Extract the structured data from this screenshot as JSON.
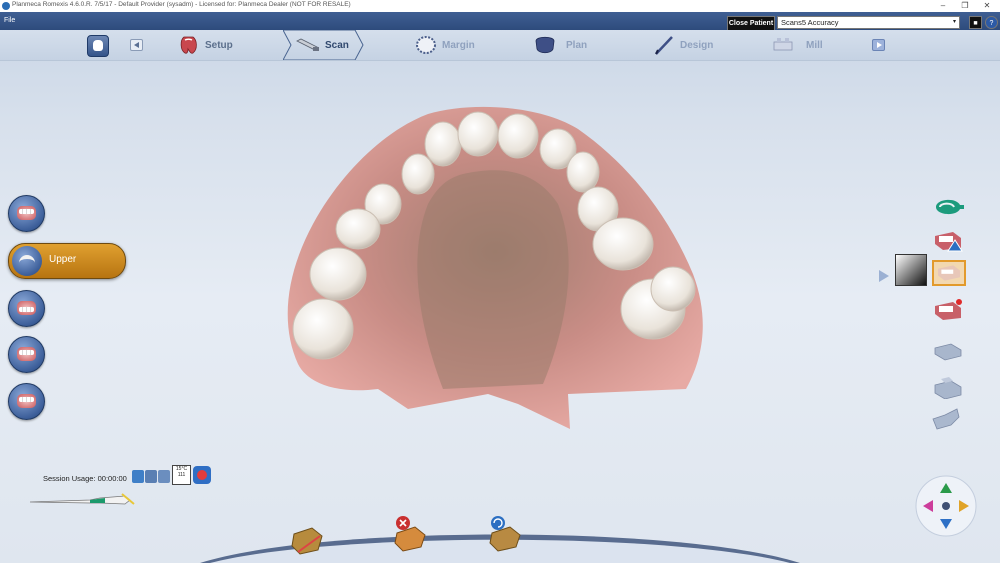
{
  "window": {
    "title": "Planmeca Romexis 4.6.0.R. 7/5/17 - Default Provider (sysadm) - Licensed for: Planmeca Dealer (NOT FOR RESALE)",
    "minimize": "–",
    "maximize": "❐",
    "close": "✕"
  },
  "menu": {
    "file": "File"
  },
  "patient_bar": {
    "close_patient": "Close Patient",
    "selected_scan": "Scans5 Accuracy",
    "caret": "▾",
    "record_icon": "■",
    "help_icon": "?"
  },
  "workflow": {
    "steps": [
      {
        "label": "Setup",
        "state": "done",
        "icon": "setup-icon"
      },
      {
        "label": "Scan",
        "state": "active",
        "icon": "scanner-icon"
      },
      {
        "label": "Margin",
        "state": "future",
        "icon": "margin-icon"
      },
      {
        "label": "Plan",
        "state": "future",
        "icon": "plan-icon"
      },
      {
        "label": "Design",
        "state": "future",
        "icon": "design-icon"
      },
      {
        "label": "Mill",
        "state": "future",
        "icon": "mill-icon"
      }
    ]
  },
  "left_panel": {
    "selected_label": "Upper"
  },
  "session": {
    "label": "Session Usage:",
    "time": "00:00:00",
    "temp_line1": "15°C",
    "temp_line2": "111"
  },
  "colors": {
    "accent_orange": "#d89122",
    "header_blue": "#34548a",
    "gum_pink": "#e8a9a3",
    "tooth_white": "#f4f1ea"
  }
}
